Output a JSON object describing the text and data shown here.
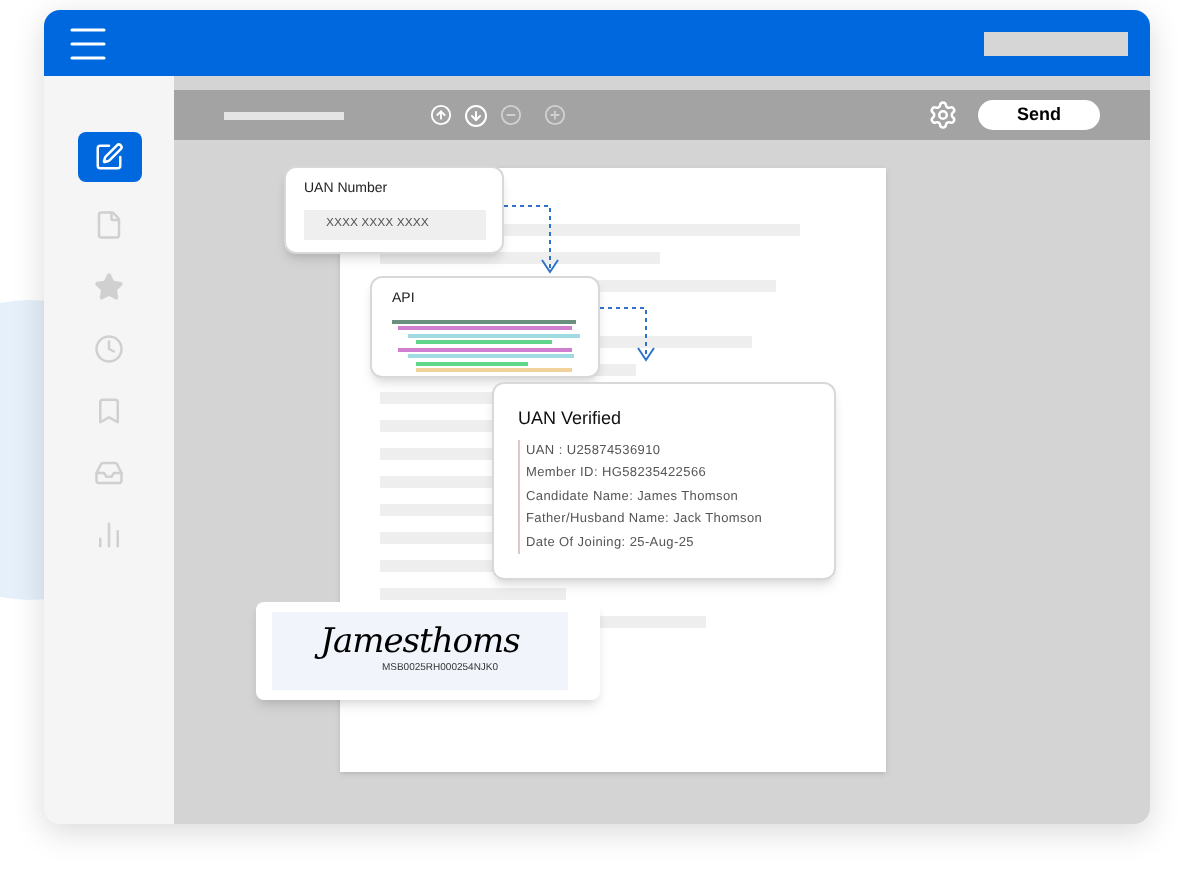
{
  "sidebar": {
    "items": [
      {
        "selected": true
      },
      {
        "selected": false
      },
      {
        "selected": false
      },
      {
        "selected": false
      },
      {
        "selected": false
      },
      {
        "selected": false
      },
      {
        "selected": false
      }
    ]
  },
  "toolbar": {
    "send_button": "Send"
  },
  "uan_input": {
    "label": "UAN Number",
    "placeholder": "XXXX XXXX XXXX"
  },
  "api_card": {
    "title": "API"
  },
  "verified_card": {
    "title": "UAN Verified",
    "lines": [
      "UAN : U25874536910",
      "Member ID: HG58235422566",
      "Candidate Name: James Thomson",
      "Father/Husband Name: Jack Thomson",
      "Date Of Joining: 25-Aug-25"
    ]
  },
  "signature": {
    "name": "Jamesthoms",
    "code": "MSB0025RH000254NJK0"
  }
}
